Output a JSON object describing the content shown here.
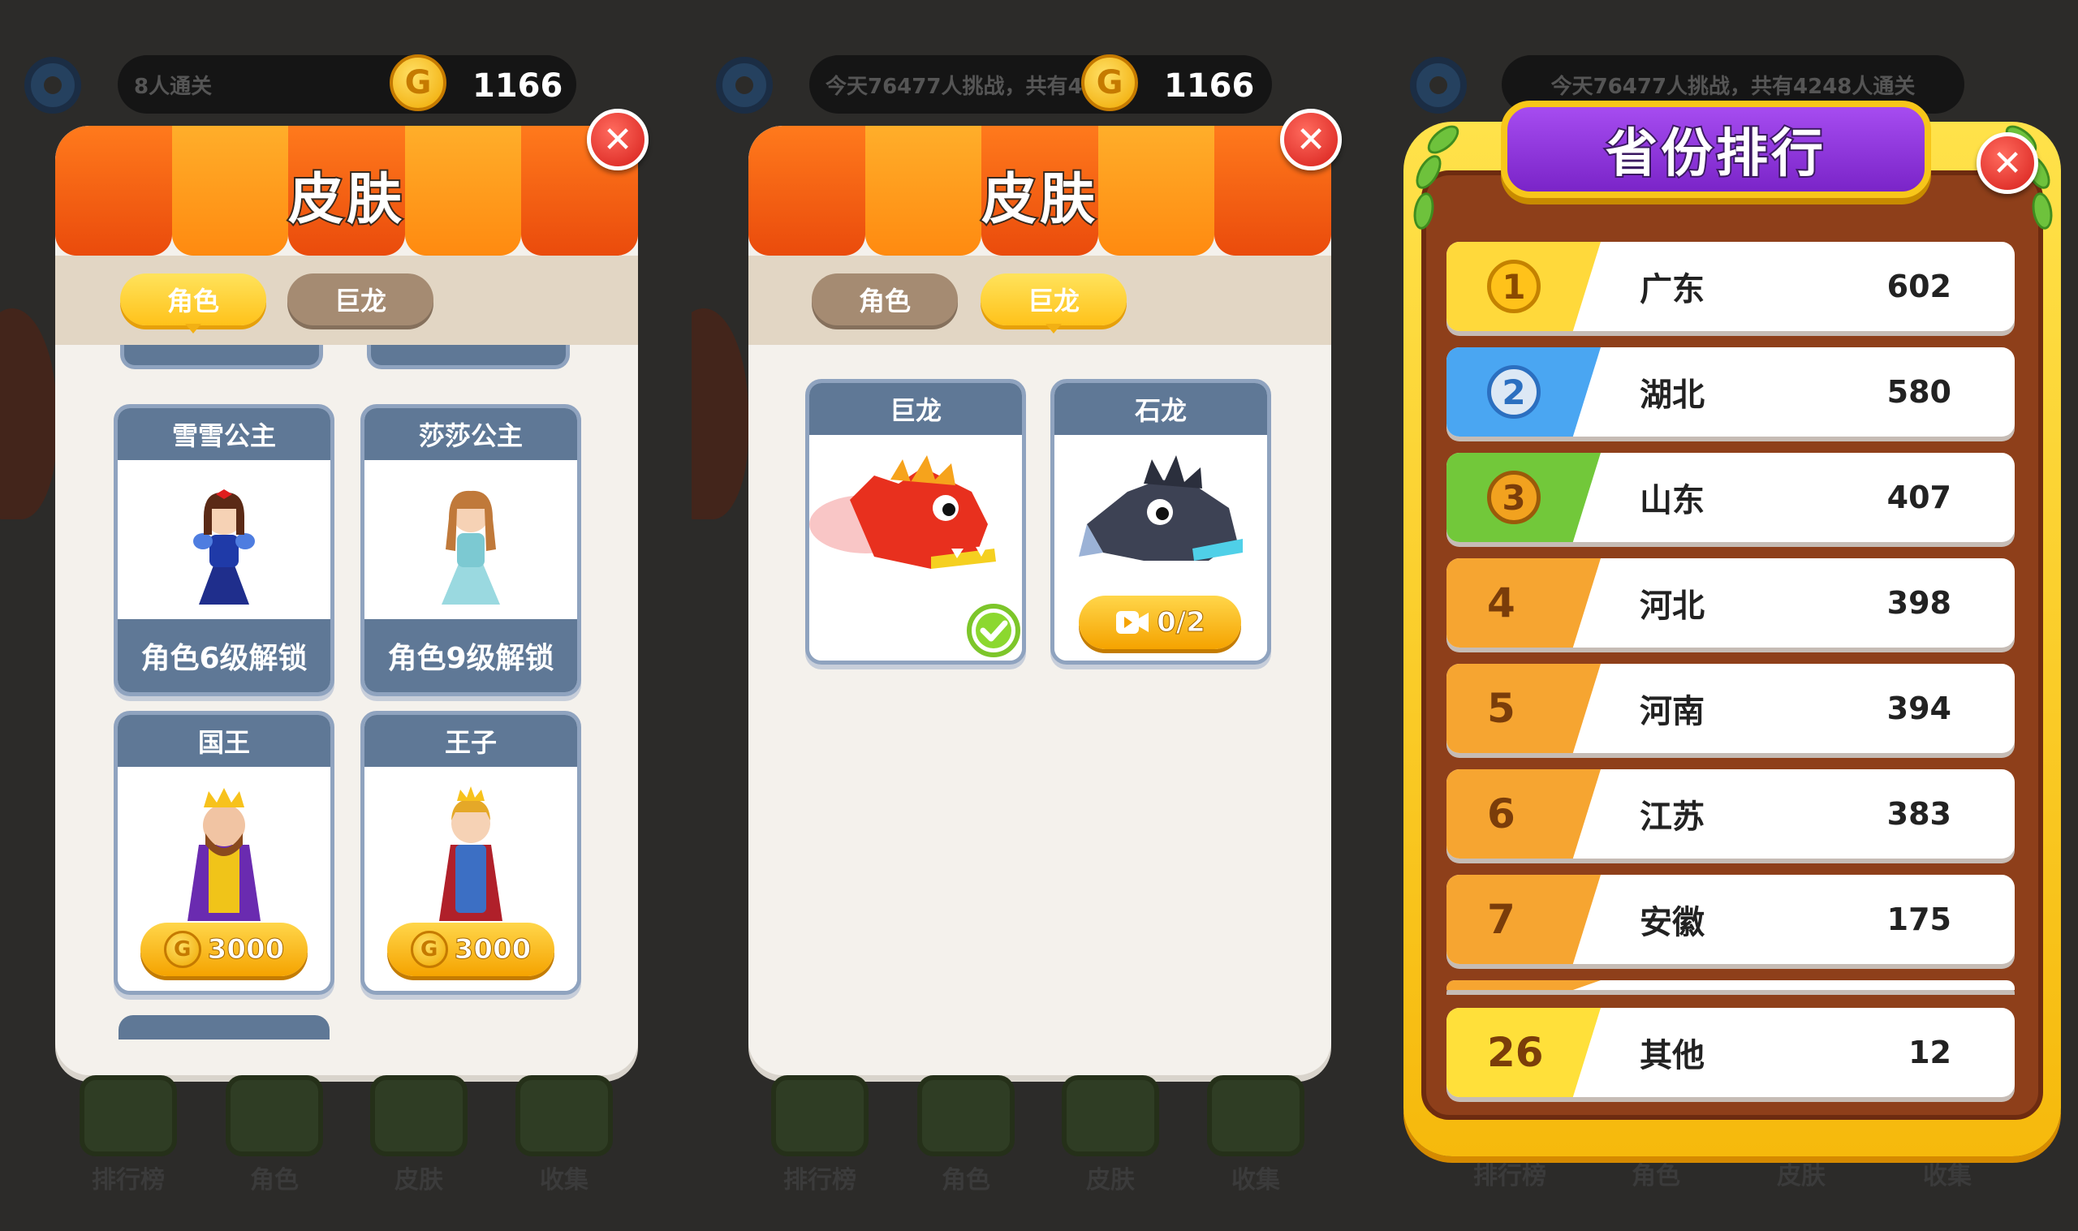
{
  "screens": [
    {
      "topbar_message": "8人通关",
      "coins": "1166",
      "coin_symbol": "G",
      "panel": {
        "title": "皮肤",
        "tabs": [
          {
            "label": "角色",
            "active": true
          },
          {
            "label": "巨龙",
            "active": false
          }
        ],
        "cards": [
          {
            "name": "雪雪公主",
            "status": "角色6级解锁",
            "figure": "princess-snow-white"
          },
          {
            "name": "莎莎公主",
            "status": "角色9级解锁",
            "figure": "princess-blue-dress"
          },
          {
            "name": "国王",
            "price": "3000",
            "figure": "king"
          },
          {
            "name": "王子",
            "price": "3000",
            "figure": "prince"
          }
        ]
      },
      "bottom_nav": [
        "排行榜",
        "角色",
        "皮肤",
        "收集"
      ]
    },
    {
      "topbar_message": "今天76477人挑战，共有4248人通关",
      "coins": "1166",
      "coin_symbol": "G",
      "panel": {
        "title": "皮肤",
        "tabs": [
          {
            "label": "角色",
            "active": false
          },
          {
            "label": "巨龙",
            "active": true
          }
        ],
        "cards": [
          {
            "name": "巨龙",
            "status": "selected",
            "figure": "red-dragon"
          },
          {
            "name": "石龙",
            "video_progress": "0/2",
            "figure": "stone-dragon"
          }
        ]
      },
      "bottom_nav": [
        "排行榜",
        "角色",
        "皮肤",
        "收集"
      ]
    },
    {
      "topbar_message": "今天76477人挑战，共有4248人通关",
      "ranking": {
        "title": "省份排行",
        "rows": [
          {
            "rank": "1",
            "name": "广东",
            "score": "602",
            "style": "gold"
          },
          {
            "rank": "2",
            "name": "湖北",
            "score": "580",
            "style": "silver"
          },
          {
            "rank": "3",
            "name": "山东",
            "score": "407",
            "style": "bronze"
          },
          {
            "rank": "4",
            "name": "河北",
            "score": "398",
            "style": "orange"
          },
          {
            "rank": "5",
            "name": "河南",
            "score": "394",
            "style": "orange"
          },
          {
            "rank": "6",
            "name": "江苏",
            "score": "383",
            "style": "orange"
          },
          {
            "rank": "7",
            "name": "安徽",
            "score": "175",
            "style": "orange"
          }
        ],
        "my_row": {
          "rank": "26",
          "name": "其他",
          "score": "12"
        }
      },
      "bottom_nav": [
        "排行榜",
        "角色",
        "皮肤",
        "收集"
      ]
    }
  ],
  "colors": {
    "awning_dark": "#ea4b0c",
    "awning_light": "#ffae2a",
    "tab_active": "#ffc21a",
    "tab_inactive": "#a58b72",
    "card_header": "#5f7896",
    "ranking_title_bg": "#7a24c8",
    "close_button": "#d61e1a"
  }
}
